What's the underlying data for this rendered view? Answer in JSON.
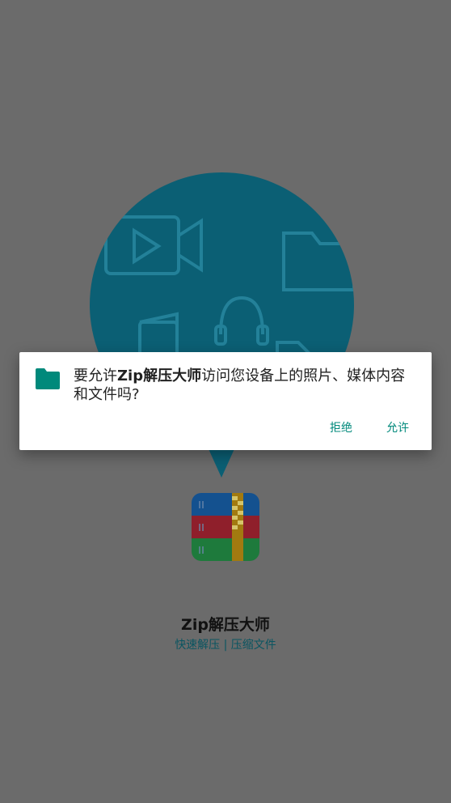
{
  "splash": {
    "app_name": "Zip解压大师",
    "tagline": "快速解压 | 压缩文件"
  },
  "icons": {
    "bubble_icons": [
      "video-icon",
      "folder-icon",
      "music-icon",
      "headset-icon",
      "document-icon"
    ],
    "logo": "zip-archive-logo",
    "dialog_icon": "folder-icon"
  },
  "dialog": {
    "message_prefix": "要允许",
    "message_app": "Zip解压大师",
    "message_suffix": "访问您设备上的照片、媒体内容和文件吗?",
    "deny_label": "拒绝",
    "allow_label": "允许"
  },
  "colors": {
    "scrim_background": "#6b6b6b",
    "bubble": "#0b5f74",
    "accent": "#00897b",
    "tagline": "#0a5561"
  }
}
